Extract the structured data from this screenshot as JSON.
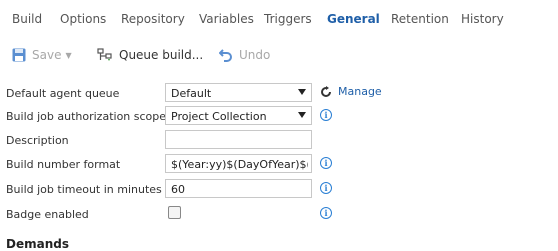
{
  "tabs": [
    {
      "label": "Build",
      "active": false
    },
    {
      "label": "Options",
      "active": false
    },
    {
      "label": "Repository",
      "active": false
    },
    {
      "label": "Variables",
      "active": false
    },
    {
      "label": "Triggers",
      "active": false
    },
    {
      "label": "General",
      "active": true
    },
    {
      "label": "Retention",
      "active": false
    },
    {
      "label": "History",
      "active": false
    }
  ],
  "toolbar": {
    "save_label": "Save",
    "queue_label": "Queue build...",
    "undo_label": "Undo"
  },
  "form": {
    "default_agent_queue": {
      "label": "Default agent queue",
      "value": "Default",
      "manage_label": "Manage"
    },
    "auth_scope": {
      "label": "Build job authorization scope",
      "value": "Project Collection"
    },
    "description": {
      "label": "Description",
      "value": ""
    },
    "build_number_format": {
      "label": "Build number format",
      "value": "$(Year:yy)$(DayOfYear)$(rev"
    },
    "timeout": {
      "label": "Build job timeout in minutes",
      "value": "60"
    },
    "badge": {
      "label": "Badge enabled",
      "checked": false
    }
  },
  "demands": {
    "heading": "Demands"
  },
  "colors": {
    "accent": "#1f5fa8",
    "info": "#2a7fd4",
    "disabled": "#a8a8a8"
  }
}
